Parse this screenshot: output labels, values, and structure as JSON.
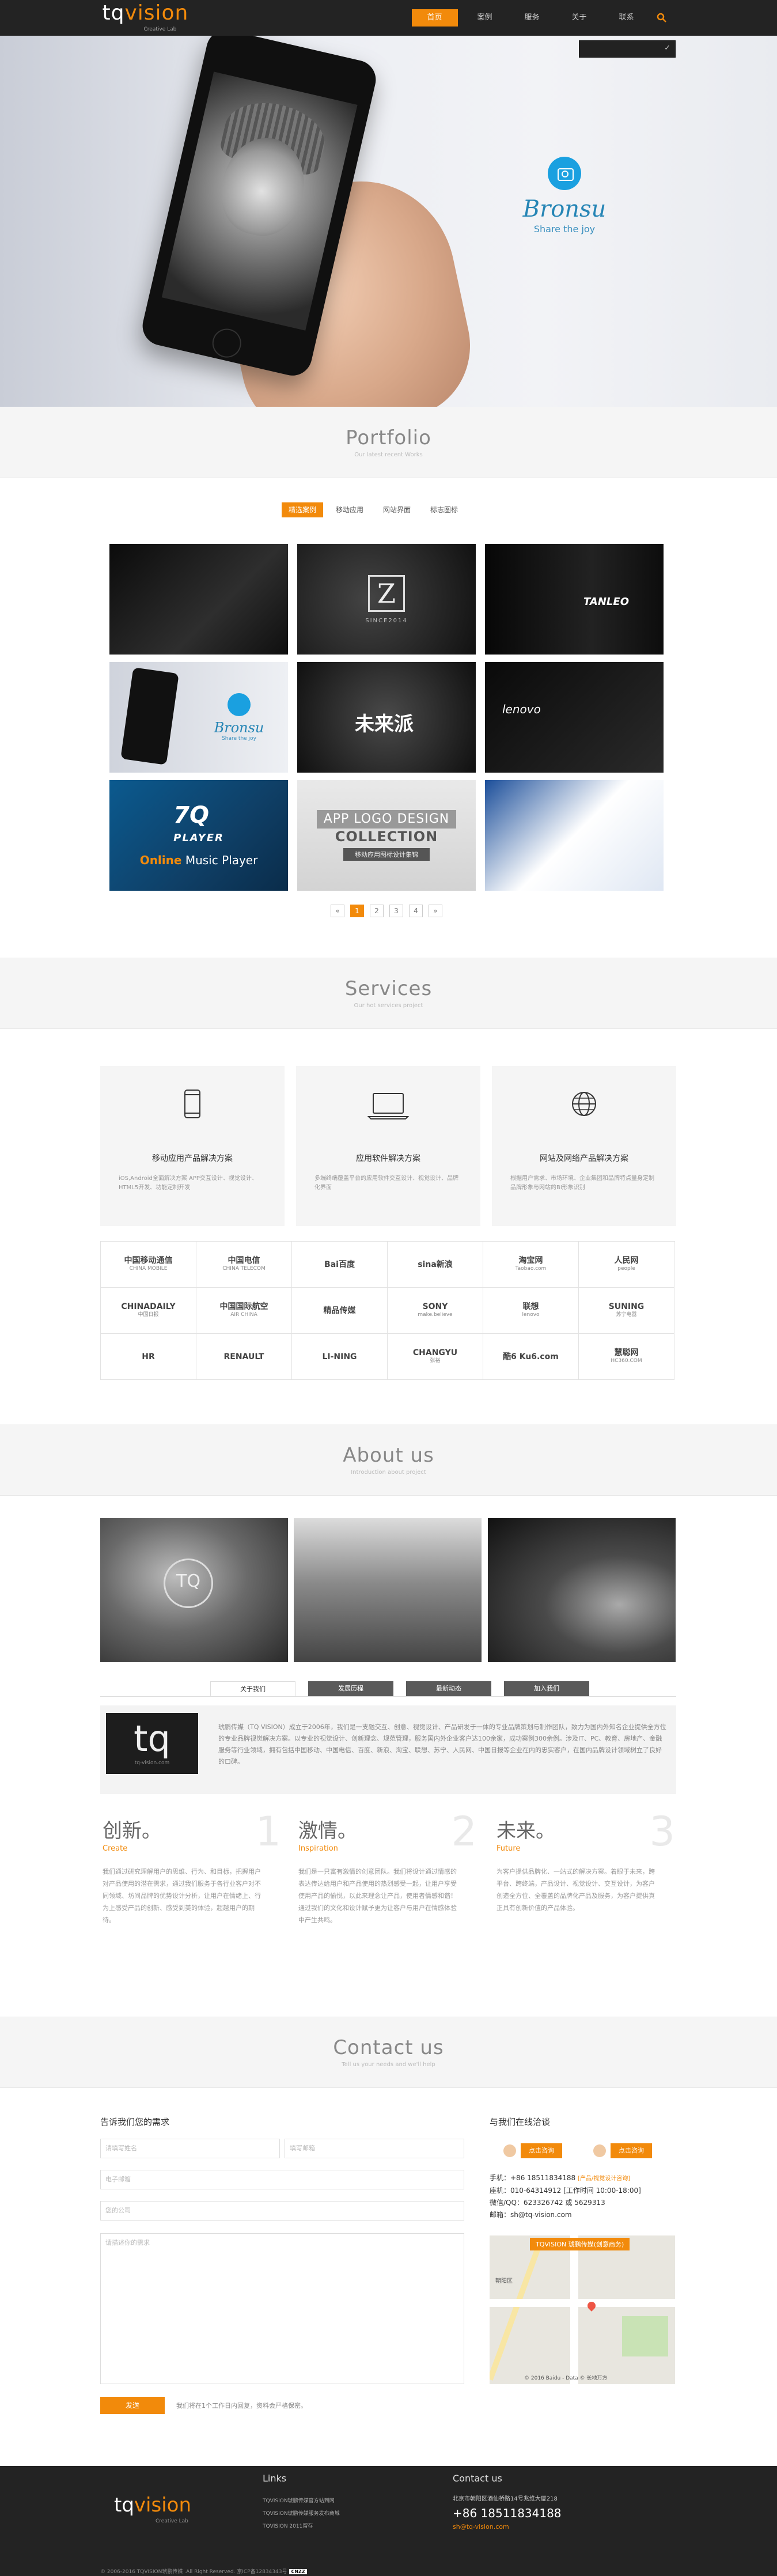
{
  "header": {
    "logo_main": "tq",
    "logo_accent": "vision",
    "logo_sub": "Creative Lab",
    "nav": [
      "首页",
      "案例",
      "服务",
      "关于",
      "联系"
    ],
    "search_placeholder": ""
  },
  "hero": {
    "brand": "Bronsu",
    "slogan": "Share the joy"
  },
  "portfolio": {
    "title": "Portfolio",
    "subtitle": "Our latest recent Works",
    "tabs": [
      "精选案例",
      "移动应用",
      "网站界面",
      "标志图标"
    ],
    "items": {
      "z_since": "SINCE2014",
      "tanleo": "TANLEO",
      "bronsu": "Bronsu",
      "bronsu_sub": "Share the joy",
      "weilaiya": "未来派",
      "lenovo": "lenovo",
      "q7_logo": "7Q",
      "q7_player": "PLAYER",
      "q7_online": "Online",
      "q7_music": "Music Player",
      "app_logo": "APP LOGO DESIGN",
      "collection": "COLLECTION",
      "app_caption": "移动应用图标设计集锦"
    },
    "pager": [
      "«",
      "1",
      "2",
      "3",
      "4",
      "»"
    ]
  },
  "services": {
    "title": "Services",
    "subtitle": "Our hot services project",
    "cards": [
      {
        "title": "移动应用产品解决方案",
        "desc": "iOS,Android全面解决方案 APP交互设计、视觉设计、HTML5开发、功能定制开发"
      },
      {
        "title": "应用软件解决方案",
        "desc": "多端终端覆盖平台的应用软件交互设计、视觉设计、品牌化界面"
      },
      {
        "title": "网站及网络产品解决方案",
        "desc": "根据用户需求、市场环境、企业集团和品牌特点量身定制品牌形象与网站的BI形象识别"
      }
    ],
    "clients": [
      {
        "name": "中国移动通信",
        "sub": "CHINA MOBILE"
      },
      {
        "name": "中国电信",
        "sub": "CHINA TELECOM"
      },
      {
        "name": "Bai百度",
        "sub": ""
      },
      {
        "name": "sina新浪",
        "sub": ""
      },
      {
        "name": "淘宝网",
        "sub": "Taobao.com"
      },
      {
        "name": "人民网",
        "sub": "people"
      },
      {
        "name": "CHINADAILY",
        "sub": "中国日报"
      },
      {
        "name": "中国国际航空",
        "sub": "AIR CHINA"
      },
      {
        "name": "精品传媒",
        "sub": ""
      },
      {
        "name": "SONY",
        "sub": "make.believe"
      },
      {
        "name": "联想",
        "sub": "lenovo"
      },
      {
        "name": "SUNING",
        "sub": "苏宁电器"
      },
      {
        "name": "HR",
        "sub": ""
      },
      {
        "name": "RENAULT",
        "sub": ""
      },
      {
        "name": "LI-NING",
        "sub": ""
      },
      {
        "name": "CHANGYU",
        "sub": "张裕"
      },
      {
        "name": "酷6 Ku6.com",
        "sub": ""
      },
      {
        "name": "慧聪网",
        "sub": "HC360.COM"
      }
    ]
  },
  "about": {
    "title": "About us",
    "subtitle": "Introduction about project",
    "tabs": [
      "关于我们",
      "发展历程",
      "最新动态",
      "加入我们"
    ],
    "logo_text": "tq",
    "logo_sub": "tq-vision.com",
    "intro": "琥鹏传媒（TQ VISION）成立于2006年，我们是一支融交互、创意、视觉设计、产品研发于一体的专业品牌策划与制作团队，致力为国内外知名企业提供全方位的专业品牌视觉解决方案。以专业的视觉设计、创新理念、规范管理，服务国内外企业客户达100余家，成功案例300余例。涉及IT、PC、教育、房地产、金融服务等行业领域，拥有包括中国移动、中国电信、百度、新浪、淘宝、联想、苏宁、人民网、中国日报等企业在内的忠实客户，在国内品牌设计领域树立了良好的口碑。",
    "columns": [
      {
        "num": "1",
        "title": "创新。",
        "en": "Create",
        "text": "我们通过研究理解用户的思维、行为、和目标，把握用户对产品使用的潜在需求，通过我们服务于各行业客户对不同领域、坊间品牌的优势设计分析，让用户在情绪上、行为上感受产品的创新、感受到美的体验，超越用户的期待。"
      },
      {
        "num": "2",
        "title": "激情。",
        "en": "Inspiration",
        "text": "我们是一只富有激情的创意团队。我们将设计通过情感的表达传达给用户和产品使用的热烈感受一起，让用户享受使用产品的愉悦，以此来理念让产品，使用者情感和谐！通过我们的文化和设计赋予更为让客户与用户在情感体验中产生共鸣。"
      },
      {
        "num": "3",
        "title": "未来。",
        "en": "Future",
        "text": "为客户提供品牌化、一站式的解决方案。着眼于未来，跨平台、跨终端，产品设计、视觉设计、交互设计，为客户创造全方位、全覆盖的品牌化产品及服务，为客户提供真正具有创新价值的产品体验。"
      }
    ]
  },
  "contact": {
    "title": "Contact us",
    "subtitle": "Tell us your needs and we'll help",
    "form_title": "告诉我们您的需求",
    "fields": {
      "name": "请填写姓名",
      "email": "填写邮箱",
      "phone": "电子邮箱",
      "company": "您的公司",
      "message": "请描述你的需求"
    },
    "send": "发送",
    "send_note": "我们将在1个工作日内回复，资料会严格保密。",
    "online_title": "与我们在线洽谈",
    "online_btn": "点击咨询",
    "phone_label": "手机：+86 18511834188",
    "phone_note": "[产品/视觉设计咨询]",
    "tel": "座机：010-64314912 [工作时间 10:00-18:00]",
    "qq": "微信/QQ：623326742 或 5629313",
    "mail": "邮箱：sh@tq-vision.com",
    "map_tag": "TQVISION 琥鹏传媒(创意商务)",
    "map_area": "朝阳区",
    "map_copy": "© 2016 Baidu - Data © 长地万方"
  },
  "footer": {
    "logo_main": "tq",
    "logo_accent": "vision",
    "logo_sub": "Creative Lab",
    "links_title": "Links",
    "links": [
      "TQVISION琥鹏传媒官方站到网",
      "TQVISION琥鹏传媒服务发布商城",
      "TQVISION 2011留存"
    ],
    "contact_title": "Contact us",
    "address": "北京市朝阳区酒仙桥路14号兆维大厦218",
    "phone": "+86 18511834188",
    "email": "sh@tq-vision.com",
    "copyright": "© 2006-2016 TQVISION琥鹏传媒 .All Right Reserved. 京ICP备12834343号",
    "cnzz": "CNZZ"
  },
  "colors": {
    "accent": "#f28a0b",
    "dark": "#232323",
    "brand_blue": "#1aa0e0"
  }
}
